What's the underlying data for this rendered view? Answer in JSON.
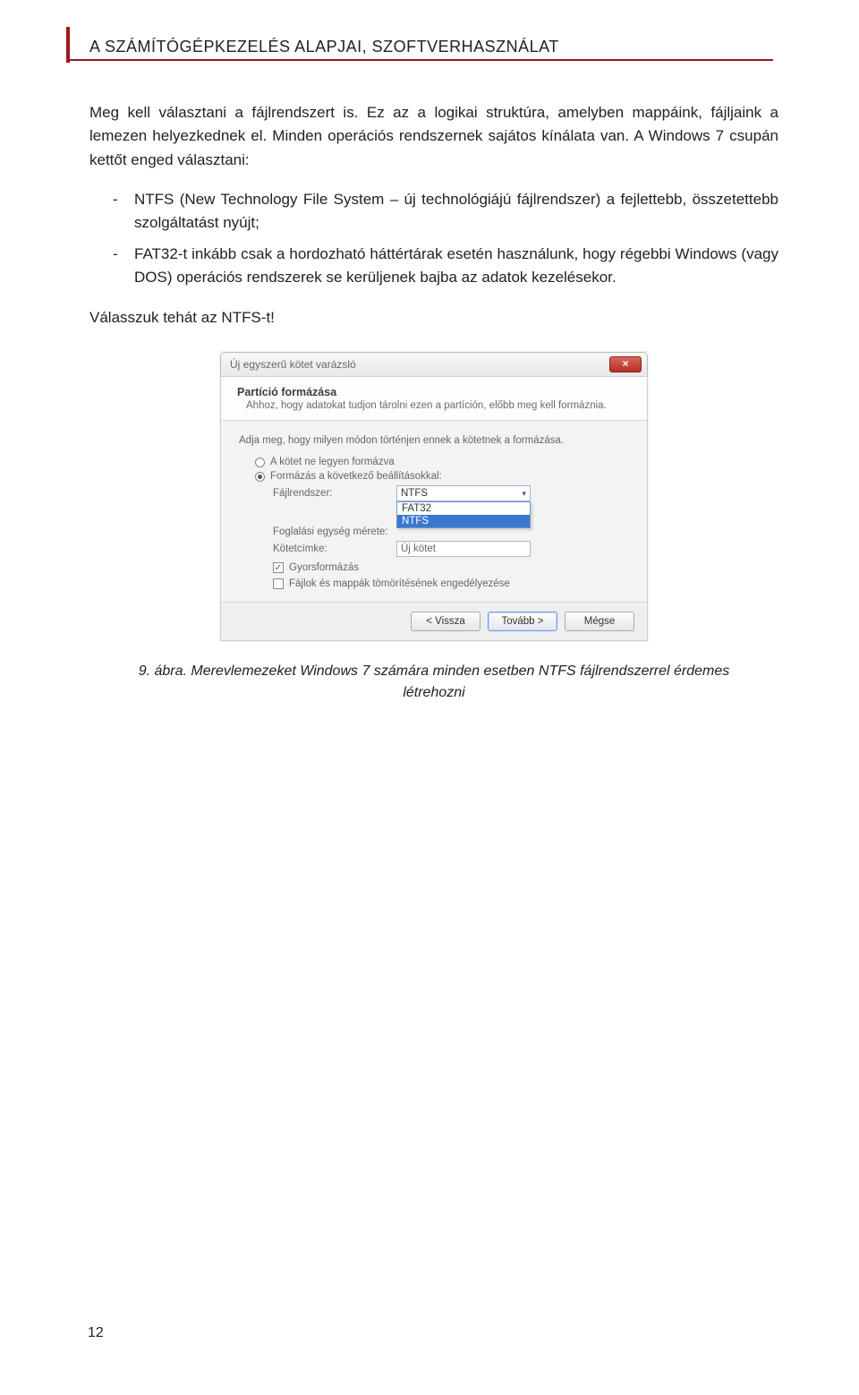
{
  "running_head": "A SZÁMÍTÓGÉPKEZELÉS ALAPJAI, SZOFTVERHASZNÁLAT",
  "para1": "Meg kell választani a fájlrendszert is. Ez az a logikai struktúra, amelyben mappáink, fájljaink a lemezen helyezkednek el. Minden operációs rendszernek sajátos kínálata van. A Windows 7 csupán kettőt enged választani:",
  "list": {
    "bullet": "-",
    "item1": "NTFS (New Technology File System – új technológiájú fájlrendszer) a fejlettebb, összetettebb szolgáltatást nyújt;",
    "item2": "FAT32-t inkább csak a hordozható háttértárak esetén használunk, hogy régebbi Windows (vagy DOS) operációs rendszerek se kerüljenek bajba az adatok kezelésekor."
  },
  "choose_line": "Válasszuk tehát az NTFS-t!",
  "caption": "9. ábra. Merevlemezeket Windows 7 számára minden esetben NTFS fájlrendszerrel érdemes létrehozni",
  "page_num": "12",
  "dialog": {
    "title": "Új egyszerű kötet varázsló",
    "close": "×",
    "header_title": "Partíció formázása",
    "header_sub": "Ahhoz, hogy adatokat tudjon tárolni ezen a partíción, előbb meg kell formáznia.",
    "intro": "Adja meg, hogy milyen módon történjen ennek a kötetnek a formázása.",
    "radio_off": "A kötet ne legyen formázva",
    "radio_on": "Formázás a következő beállításokkal:",
    "label_fs": "Fájlrendszer:",
    "value_fs": "NTFS",
    "opt_fat32": "FAT32",
    "opt_ntfs": "NTFS",
    "label_alloc": "Foglalási egység mérete:",
    "label_volname": "Kötetcímke:",
    "value_volname": "Új kötet",
    "chk_quick": "Gyorsformázás",
    "chk_compress": "Fájlok és mappák tömörítésének engedélyezése",
    "btn_back": "< Vissza",
    "btn_next": "Tovább >",
    "btn_cancel": "Mégse"
  }
}
